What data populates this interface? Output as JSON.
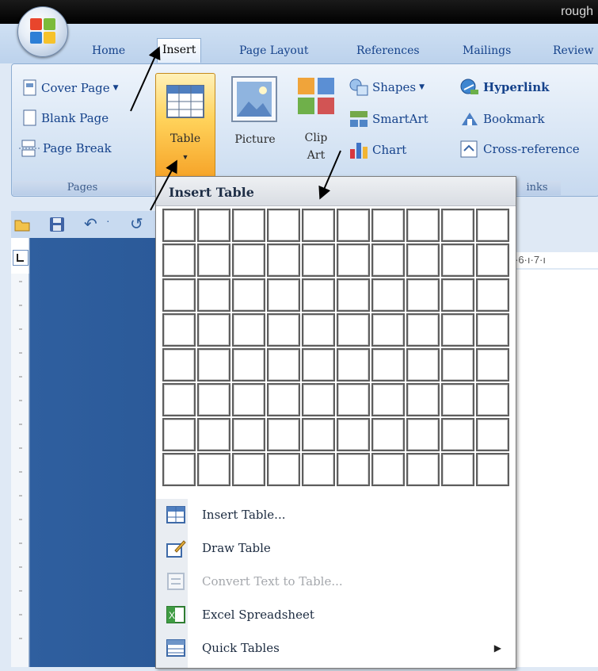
{
  "window": {
    "title_partial": "rough"
  },
  "tabs": [
    {
      "label": "Home"
    },
    {
      "label": "Insert",
      "active": true
    },
    {
      "label": "Page Layout"
    },
    {
      "label": "References"
    },
    {
      "label": "Mailings"
    },
    {
      "label": "Review"
    }
  ],
  "ribbon": {
    "pages": {
      "cover_page": "Cover Page",
      "blank_page": "Blank Page",
      "page_break": "Page Break",
      "group_label": "Pages"
    },
    "tables": {
      "table_label": "Table"
    },
    "illustrations": {
      "picture": "Picture",
      "clip_art_line1": "Clip",
      "clip_art_line2": "Art",
      "shapes": "Shapes",
      "smartart": "SmartArt",
      "chart": "Chart"
    },
    "links": {
      "hyperlink": "Hyperlink",
      "bookmark": "Bookmark",
      "cross_reference": "Cross-reference",
      "group_label_partial": "inks"
    }
  },
  "ruler": {
    "top_partial": "·6·ı·7·ı"
  },
  "dropdown": {
    "header": "Insert Table",
    "grid": {
      "columns": 10,
      "rows": 8
    },
    "items": [
      {
        "label": "Insert Table...",
        "icon": "insert-table-icon",
        "enabled": true
      },
      {
        "label": "Draw Table",
        "icon": "pencil-table-icon",
        "enabled": true
      },
      {
        "label": "Convert Text to Table...",
        "icon": "convert-text-icon",
        "enabled": false
      },
      {
        "label": "Excel Spreadsheet",
        "icon": "excel-icon",
        "enabled": true
      },
      {
        "label": "Quick Tables",
        "icon": "quick-tables-icon",
        "enabled": true,
        "has_submenu": true
      }
    ]
  },
  "colors": {
    "ribbon_text": "#15428b",
    "table_button": "#f6a429",
    "doc_blue": "#2b5a99"
  }
}
